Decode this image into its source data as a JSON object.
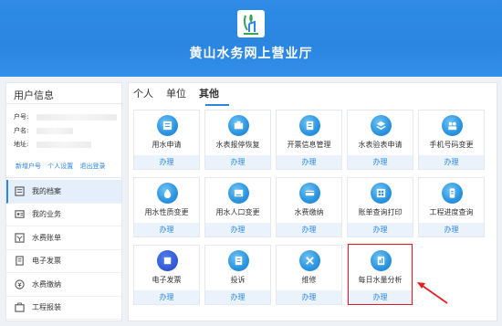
{
  "header": {
    "site_title": "黄山水务网上营业厅",
    "logo_icon": "water-utility-logo-icon"
  },
  "sidebar": {
    "title": "用户信息",
    "info": [
      {
        "label": "户号:"
      },
      {
        "label": "户名:"
      },
      {
        "label": "地址:"
      }
    ],
    "links": [
      "新增户号",
      "个人设置",
      "退出登录"
    ],
    "menu": [
      {
        "label": "我的档案",
        "icon": "archive-icon",
        "active": true
      },
      {
        "label": "我的业务",
        "icon": "business-icon"
      },
      {
        "label": "水费账单",
        "icon": "bill-icon"
      },
      {
        "label": "电子发票",
        "icon": "invoice-icon"
      },
      {
        "label": "水费缴纳",
        "icon": "payment-icon"
      },
      {
        "label": "工程报装",
        "icon": "project-icon"
      }
    ]
  },
  "tabs": [
    {
      "label": "个人"
    },
    {
      "label": "单位"
    },
    {
      "label": "其他",
      "active": true
    }
  ],
  "tiles": [
    {
      "label": "用水申请",
      "button": "办理",
      "icon": "water-apply-icon"
    },
    {
      "label": "水表报停恢复",
      "button": "办理",
      "icon": "meter-suspend-icon"
    },
    {
      "label": "开票信息管理",
      "button": "办理",
      "icon": "invoice-info-icon"
    },
    {
      "label": "水表验表申请",
      "button": "办理",
      "icon": "meter-check-icon"
    },
    {
      "label": "手机号码变更",
      "button": "办理",
      "icon": "phone-change-icon"
    },
    {
      "label": "用水性质变更",
      "button": "办理",
      "icon": "water-nature-icon"
    },
    {
      "label": "用水人口变更",
      "button": "办理",
      "icon": "population-change-icon"
    },
    {
      "label": "水费缴纳",
      "button": "办理",
      "icon": "fee-pay-icon"
    },
    {
      "label": "账单查询打印",
      "button": "办理",
      "icon": "bill-print-icon"
    },
    {
      "label": "工程进度查询",
      "button": "办理",
      "icon": "project-progress-icon"
    },
    {
      "label": "电子发票",
      "button": "办理",
      "icon": "e-invoice-icon"
    },
    {
      "label": "投诉",
      "button": "办理",
      "icon": "complaint-icon"
    },
    {
      "label": "维修",
      "button": "办理",
      "icon": "repair-icon"
    },
    {
      "label": "每日水量分析",
      "button": "办理",
      "icon": "daily-water-analysis-icon"
    }
  ],
  "colors": {
    "primary": "#2a86e0",
    "highlight": "#e02020"
  }
}
